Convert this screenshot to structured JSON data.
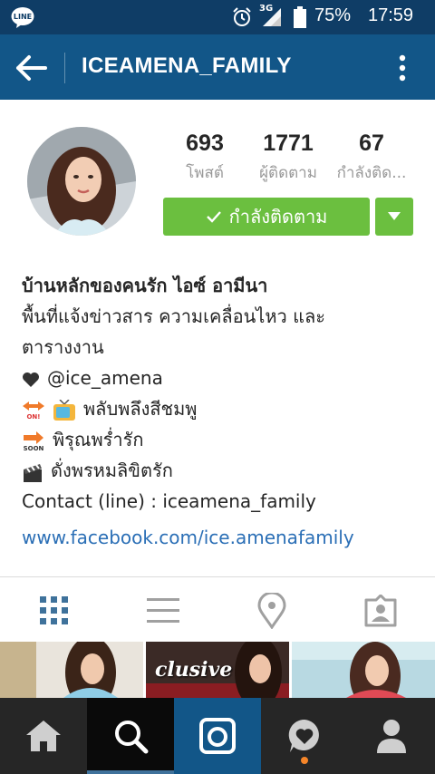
{
  "status_bar": {
    "line_badge": "LINE",
    "network": "3G",
    "battery": "75%",
    "time": "17:59"
  },
  "app_bar": {
    "title": "ICEAMENA_FAMILY"
  },
  "profile": {
    "stats": {
      "posts": {
        "value": "693",
        "label": "โพสต์"
      },
      "followers": {
        "value": "1771",
        "label": "ผู้ติดตาม"
      },
      "following": {
        "value": "67",
        "label": "กำลังติด..."
      }
    },
    "follow_button_label": "กำลังติดตาม",
    "colors": {
      "follow_green": "#6bbf3f",
      "header_blue": "#125688",
      "link_blue": "#2b6fb6"
    }
  },
  "bio": {
    "name": "บ้านหลักของคนรัก ไอซ์ อามีนา",
    "line1": "พื้นที่แจ้งข่าวสาร ความเคลื่อนไหว และ",
    "line2": "ตารางงาน",
    "handle": "@ice_amena",
    "show1": "พลับพลึงสีชมพู",
    "show2": "พิรุณพร่ำรัก",
    "show3": "ดั่งพรหมลิขิตรัก",
    "contact": "Contact (line) : iceamena_family",
    "link": "www.facebook.com/ice.amenafamily"
  },
  "tabs": [
    "grid-icon",
    "list-icon",
    "location-pin-icon",
    "tagged-photos-icon"
  ],
  "photos": {
    "caption2": "clusive"
  },
  "bottom_nav": [
    "home-icon",
    "search-icon",
    "camera-icon",
    "activity-heart-icon",
    "profile-icon"
  ]
}
